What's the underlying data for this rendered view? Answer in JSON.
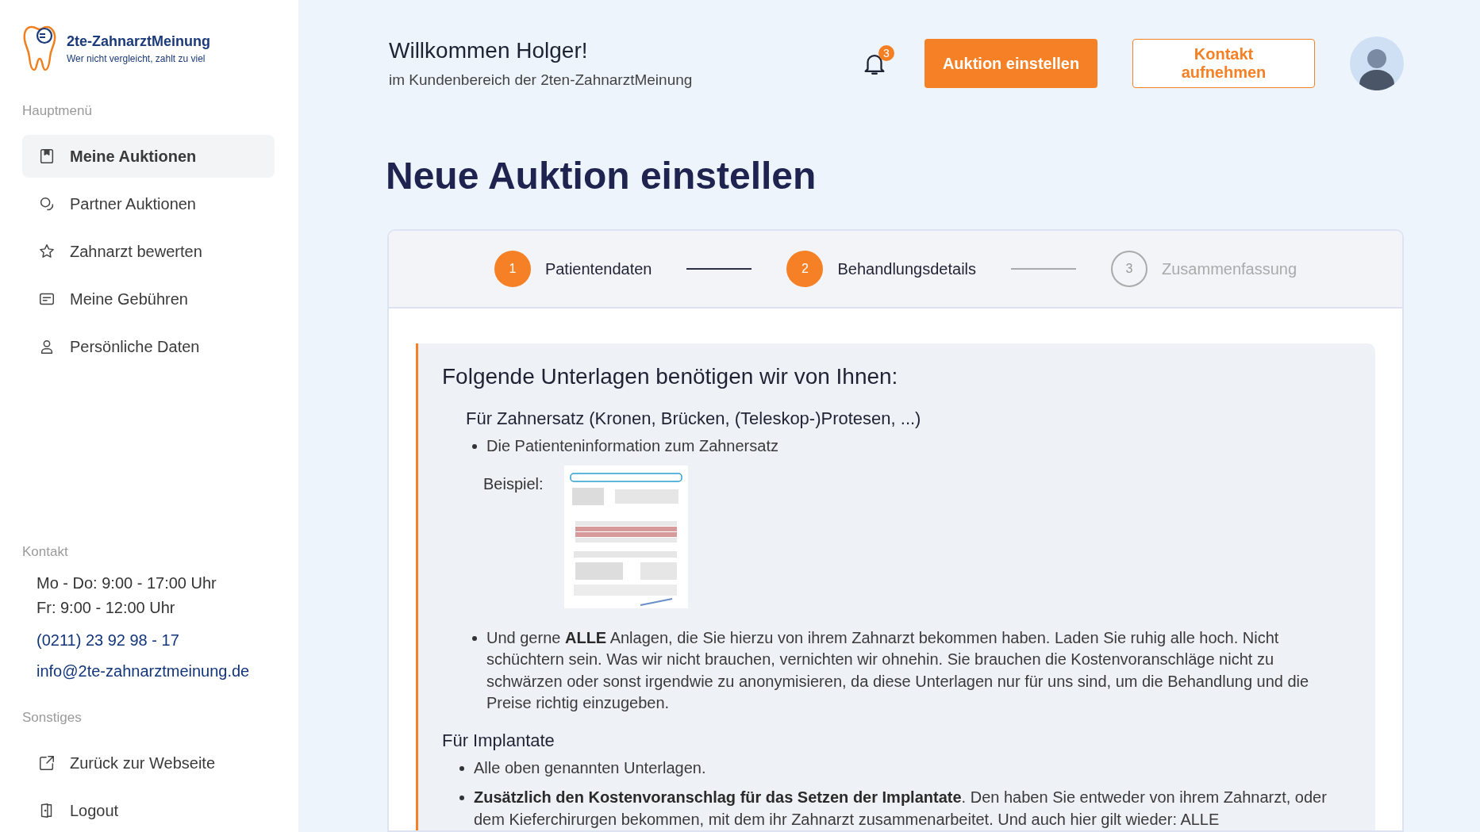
{
  "sidebar": {
    "logo": {
      "title": "2te-ZahnarztMeinung",
      "tagline": "Wer nicht vergleicht, zahlt zu viel"
    },
    "main_menu": {
      "heading": "Hauptmenü",
      "items": [
        {
          "label": "Meine Auktionen",
          "selected": true
        },
        {
          "label": "Partner Auktionen",
          "selected": false
        },
        {
          "label": "Zahnarzt bewerten",
          "selected": false
        },
        {
          "label": "Meine Gebühren",
          "selected": false
        },
        {
          "label": "Persönliche Daten",
          "selected": false
        }
      ]
    },
    "contact": {
      "heading": "Kontakt",
      "hours": [
        "Mo - Do: 9:00 - 17:00 Uhr",
        "Fr: 9:00 - 12:00 Uhr"
      ],
      "phone": "(0211) 23 92 98 - 17",
      "email": "info@2te-zahnarztmeinung.de"
    },
    "other_menu": {
      "heading": "Sonstiges",
      "items": [
        {
          "label": "Zurück zur Webseite",
          "selected": false
        },
        {
          "label": "Logout",
          "selected": false
        }
      ]
    }
  },
  "header": {
    "greeting": "Willkommen Holger!",
    "subtitle": "im Kundenbereich der 2ten-ZahnarztMeinung",
    "notifications": "3",
    "primary_button": "Auktion einstellen",
    "secondary_button": "Kontakt aufnehmen"
  },
  "page_title": "Neue Auktion einstellen",
  "stepper": [
    {
      "number": "1",
      "label": "Patientendaten",
      "reached": true
    },
    {
      "number": "2",
      "label": "Behandlungsdetails",
      "reached": true
    },
    {
      "number": "3",
      "label": "Zusammenfassung",
      "reached": false
    }
  ],
  "notice": {
    "heading": "Folgende Unterlagen benötigen wir von Ihnen:",
    "sections": [
      {
        "title": "Für Zahnersatz (Kronen, Brücken, (Teleskop-)Protesen, ...)",
        "items": [
          {
            "text": "Die Patienteninformation zum Zahnersatz",
            "example": {
              "label": "Beispiel:"
            }
          },
          {
            "text": "Und gerne **ALLE** Anlagen, die Sie hierzu von ihrem Zahnarzt bekommen haben. Laden Sie ruhig alle hoch. Nicht schüchtern sein. Was wir nicht brauchen, vernichten wir ohnehin. Sie brauchen die Kostenvoranschläge nicht zu schwärzen oder sonst irgendwie zu anonymisieren, da diese Unterlagen nur für uns sind, um die Behandlung und die Preise richtig einzugeben."
          }
        ]
      },
      {
        "title": "Für Implantate",
        "items": [
          {
            "text": "Alle oben genannten Unterlagen."
          },
          {
            "text": "**Zusätzlich den Kostenvoranschlag für das Setzen der Implantate**. Den haben Sie entweder von ihrem Zahnarzt, oder dem Kieferchirurgen bekommen, mit dem ihr Zahnarzt zusammenarbeitet. Und auch hier gilt wieder: ALLE"
          }
        ]
      }
    ]
  }
}
